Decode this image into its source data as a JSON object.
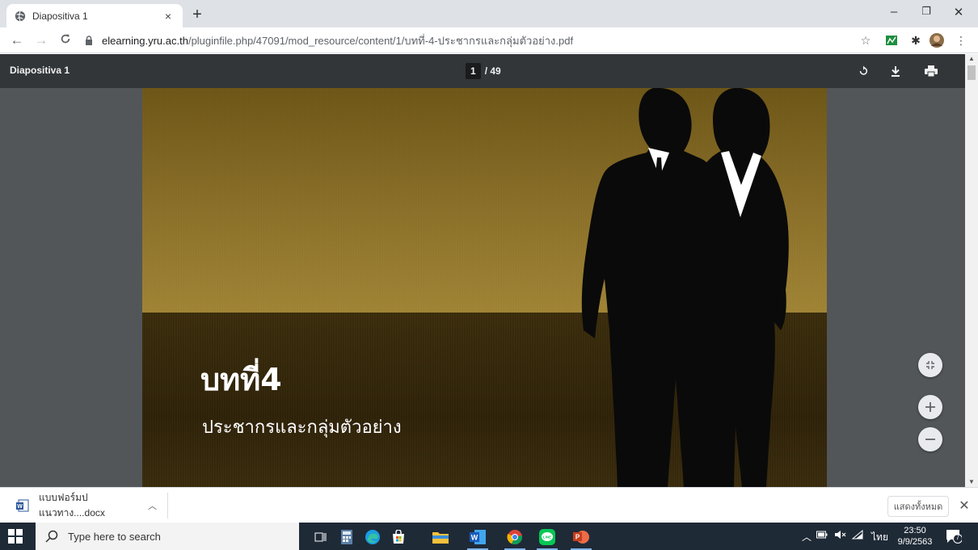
{
  "browser": {
    "tab_title": "Diapositiva 1",
    "tab_close": "×",
    "new_tab": "+",
    "window": {
      "minimize": "–",
      "maximize": "❐",
      "close": "✕"
    },
    "url_host": "elearning.yru.ac.th",
    "url_path": "/pluginfile.php/47091/mod_resource/content/1/บทที่-4-ประชากรและกลุ่มตัวอย่าง.pdf"
  },
  "pdf": {
    "title": "Diapositiva 1",
    "current_page": "1",
    "total_pages": "/ 49"
  },
  "slide": {
    "heading": "บทที่4",
    "subheading": "ประชากรและกลุ่มตัวอย่าง"
  },
  "downloads": {
    "file_name": "แบบฟอร์มปแนวทาง....docx",
    "show_all": "แสดงทั้งหมด",
    "close": "✕"
  },
  "taskbar": {
    "search_placeholder": "Type here to search",
    "language": "ไทย",
    "time": "23:50",
    "date": "9/9/2563",
    "notification_count": "7"
  },
  "colors": {
    "pdf_toolbar": "#323639",
    "viewer_bg": "#525659",
    "taskbar": "#1f2a37"
  }
}
